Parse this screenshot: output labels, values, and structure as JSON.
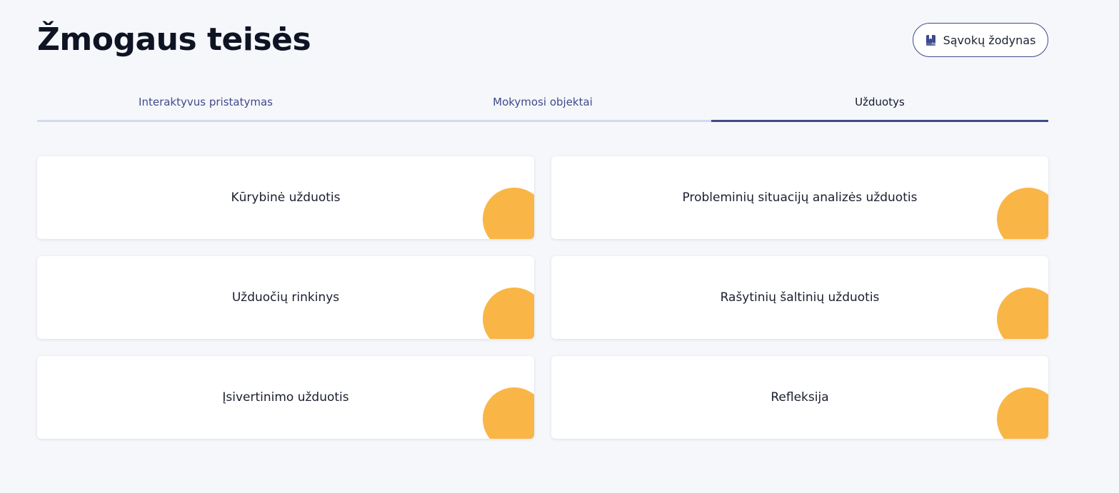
{
  "header": {
    "title": "Žmogaus teisės",
    "glossary_button": {
      "label": "Sąvokų žodynas",
      "icon": "book-icon"
    }
  },
  "tabs": [
    {
      "label": "Interaktyvus pristatymas",
      "active": false
    },
    {
      "label": "Mokymosi objektai",
      "active": false
    },
    {
      "label": "Užduotys",
      "active": true
    }
  ],
  "cards": [
    {
      "title": "Kūrybinė užduotis"
    },
    {
      "title": "Probleminių situacijų analizės užduotis"
    },
    {
      "title": "Užduočių rinkinys"
    },
    {
      "title": "Rašytinių šaltinių užduotis"
    },
    {
      "title": "Įsivertinimo užduotis"
    },
    {
      "title": "Refleksija"
    }
  ],
  "colors": {
    "accent": "#3f4a8a",
    "tab_inactive_underline": "#d3d9ee",
    "card_decoration": "#f9b646",
    "background": "#f6f7fb",
    "title_text": "#0f1424"
  }
}
